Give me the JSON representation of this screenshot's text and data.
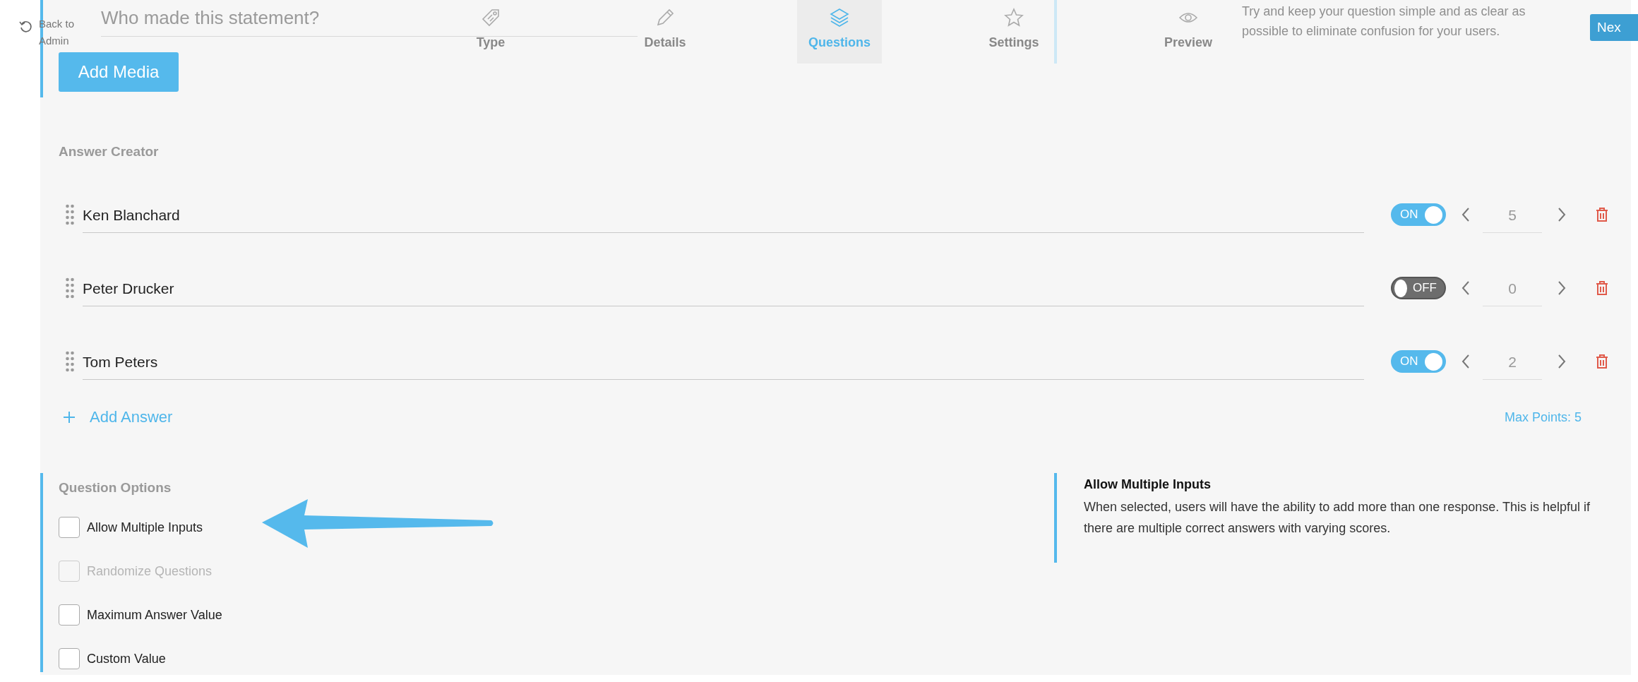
{
  "header": {
    "back_label": "Back to Admin",
    "tabs": [
      {
        "label": "Type",
        "selected": false
      },
      {
        "label": "Details",
        "selected": false
      },
      {
        "label": "Questions",
        "selected": true
      },
      {
        "label": "Settings",
        "selected": false
      },
      {
        "label": "Preview",
        "selected": false
      }
    ]
  },
  "question": {
    "placeholder": "Who made this statement?",
    "add_media": "Add Media",
    "hint": "Try and keep your question simple and as clear as possible to eliminate confusion for your users.",
    "next_button": "Nex"
  },
  "answer_creator": {
    "title": "Answer Creator",
    "answers": [
      {
        "text": "Ken Blanchard",
        "on": true,
        "toggle_label": "ON",
        "points": "5"
      },
      {
        "text": "Peter Drucker",
        "on": false,
        "toggle_label": "OFF",
        "points": "0"
      },
      {
        "text": "Tom Peters",
        "on": true,
        "toggle_label": "ON",
        "points": "2"
      }
    ],
    "add_answer": "Add Answer",
    "max_points": "Max Points: 5"
  },
  "question_options": {
    "title": "Question Options",
    "options": [
      {
        "label": "Allow Multiple Inputs",
        "checked": false,
        "disabled": false
      },
      {
        "label": "Randomize Questions",
        "checked": false,
        "disabled": true
      },
      {
        "label": "Maximum Answer Value",
        "checked": false,
        "disabled": false
      },
      {
        "label": "Custom Value",
        "checked": false,
        "disabled": false
      }
    ],
    "info_title": "Allow Multiple Inputs",
    "info_text": "When selected, users will have the ability to add more than one response. This is helpful if there are multiple correct answers with varying scores."
  }
}
